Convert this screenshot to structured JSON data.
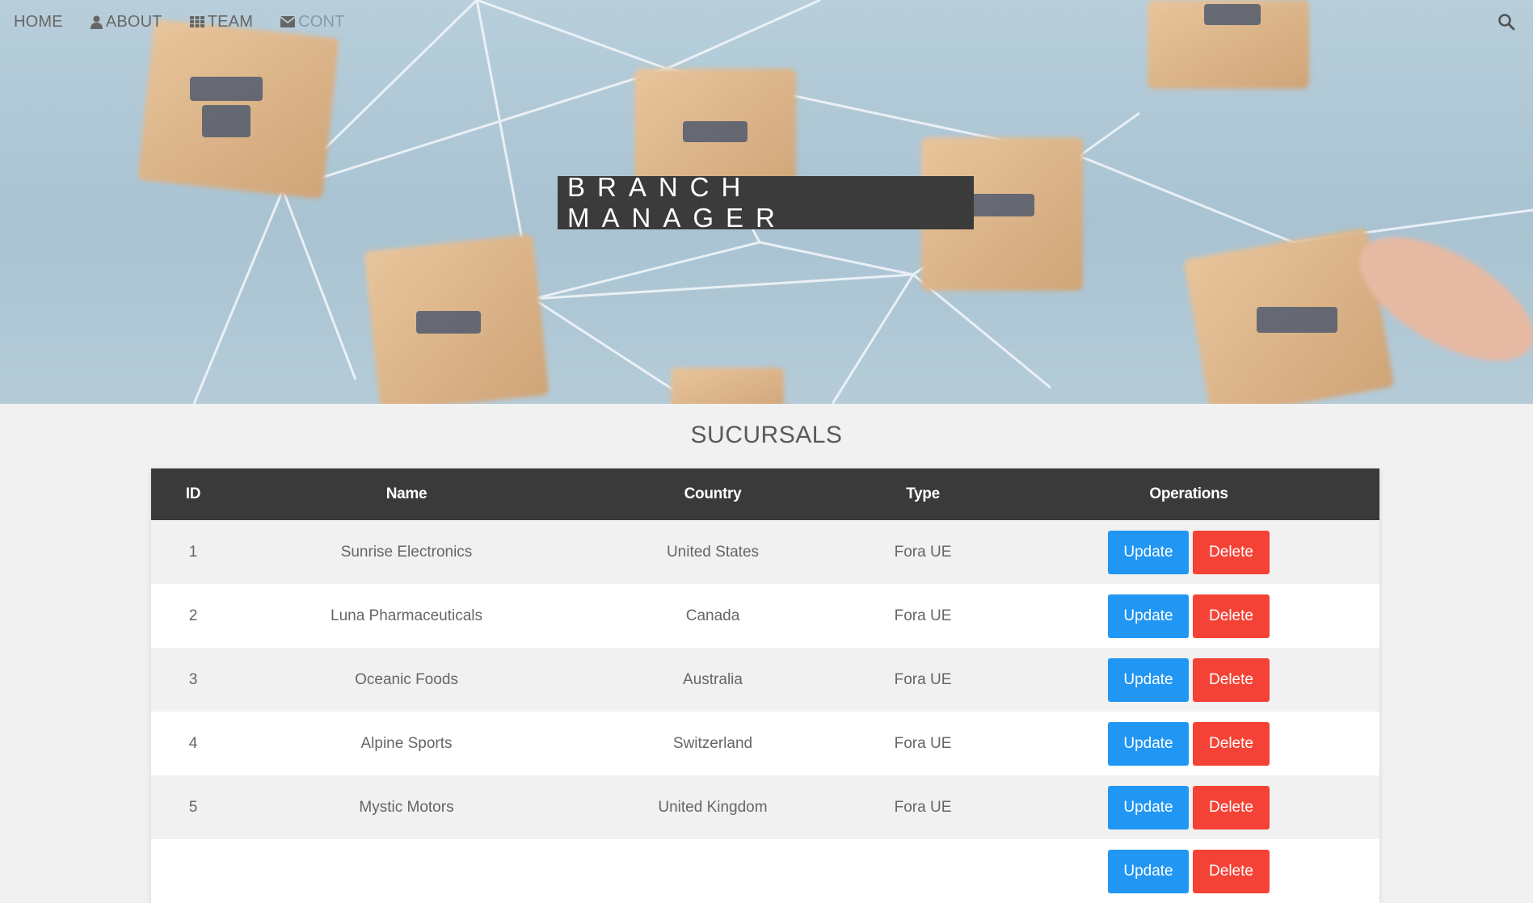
{
  "nav": {
    "items": [
      {
        "label": "HOME",
        "icon": ""
      },
      {
        "label": "ABOUT",
        "icon": "user-icon"
      },
      {
        "label": "TEAM",
        "icon": "grid-icon"
      },
      {
        "label": "CONT",
        "icon": "envelope-icon"
      }
    ],
    "search_icon": "search-icon"
  },
  "hero": {
    "title": "BRANCH MANAGER"
  },
  "main": {
    "section_title": "SUCURSALS",
    "table": {
      "headers": [
        "ID",
        "Name",
        "Country",
        "Type",
        "Operations"
      ],
      "rows": [
        {
          "id": "1",
          "name": "Sunrise Electronics",
          "country": "United States",
          "type": "Fora UE"
        },
        {
          "id": "2",
          "name": "Luna Pharmaceuticals",
          "country": "Canada",
          "type": "Fora UE"
        },
        {
          "id": "3",
          "name": "Oceanic Foods",
          "country": "Australia",
          "type": "Fora UE"
        },
        {
          "id": "4",
          "name": "Alpine Sports",
          "country": "Switzerland",
          "type": "Fora UE"
        },
        {
          "id": "5",
          "name": "Mystic Motors",
          "country": "United Kingdom",
          "type": "Fora UE"
        },
        {
          "id": "",
          "name": "",
          "country": "",
          "type": ""
        }
      ],
      "update_label": "Update",
      "delete_label": "Delete"
    }
  },
  "colors": {
    "header_bg": "#3a3a3a",
    "update": "#2196f3",
    "delete": "#f44336",
    "hero_bg": "#aac4d3"
  }
}
